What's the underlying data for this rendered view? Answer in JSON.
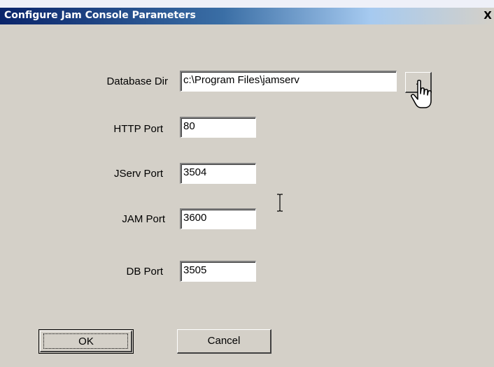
{
  "window": {
    "title": "Configure Jam Console Parameters",
    "close_label": "X"
  },
  "form": {
    "database_dir": {
      "label": "Database Dir",
      "value": "c:\\Program Files\\jamserv",
      "browse_label": ".."
    },
    "http_port": {
      "label": "HTTP Port",
      "value": "80"
    },
    "jserv_port": {
      "label": "JServ Port",
      "value": "3504"
    },
    "jam_port": {
      "label": "JAM Port",
      "value": "3600"
    },
    "db_port": {
      "label": "DB Port",
      "value": "3505"
    }
  },
  "buttons": {
    "ok_label": "OK",
    "cancel_label": "Cancel"
  },
  "cursors": [
    "hand-pointer-cursor",
    "text-ibeam-cursor"
  ]
}
